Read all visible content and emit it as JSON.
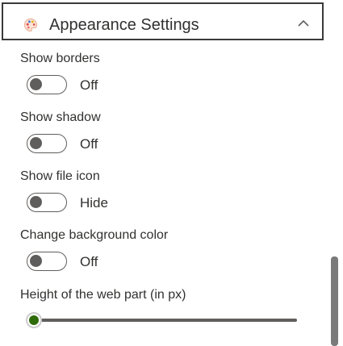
{
  "section": {
    "title": "Appearance Settings",
    "icon": "palette-icon",
    "chevron_icon": "chevron-up-icon",
    "expanded": true
  },
  "fields": [
    {
      "label": "Show borders",
      "state": "Off",
      "on": false
    },
    {
      "label": "Show shadow",
      "state": "Off",
      "on": false
    },
    {
      "label": "Show file icon",
      "state": "Hide",
      "on": false
    },
    {
      "label": "Change background color",
      "state": "Off",
      "on": false
    }
  ],
  "height_slider": {
    "label": "Height of the web part (in px)",
    "fraction": 0
  },
  "colors": {
    "accent": "#498205",
    "toggle_off": "#605e5c",
    "text": "#323130"
  }
}
